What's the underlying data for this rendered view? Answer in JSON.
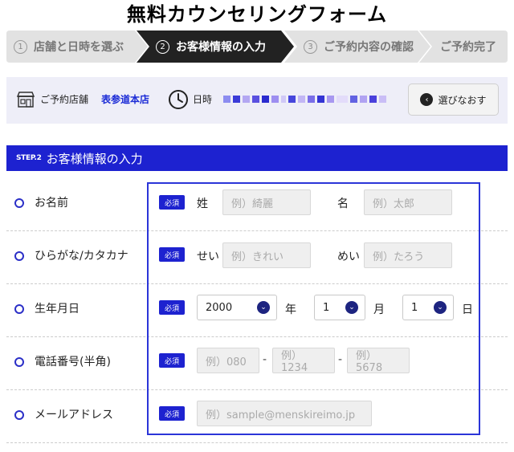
{
  "title": "無料カウンセリングフォーム",
  "steps": [
    {
      "num": "1",
      "label": "店舗と日時を選ぶ",
      "active": false
    },
    {
      "num": "2",
      "label": "お客様情報の入力",
      "active": true
    },
    {
      "num": "3",
      "label": "ご予約内容の確認",
      "active": false
    },
    {
      "num": "",
      "label": "ご予約完了",
      "active": false
    }
  ],
  "store": {
    "label": "ご予約店舗",
    "name": "表参道本店",
    "datetime_label": "日時",
    "redo_label": "選びなおす"
  },
  "section": {
    "step": "STEP.2",
    "title": "お客様情報の入力"
  },
  "required_label": "必須",
  "form": {
    "name": {
      "label": "お名前",
      "last_prefix": "姓",
      "last_placeholder": "例）綺麗",
      "first_prefix": "名",
      "first_placeholder": "例）太郎"
    },
    "kana": {
      "label": "ひらがな/カタカナ",
      "last_prefix": "せい",
      "last_placeholder": "例）きれい",
      "first_prefix": "めい",
      "first_placeholder": "例）たろう"
    },
    "birthday": {
      "label": "生年月日",
      "year_value": "2000",
      "year_suffix": "年",
      "month_value": "1",
      "month_suffix": "月",
      "day_value": "1",
      "day_suffix": "日"
    },
    "phone": {
      "label": "電話番号(半角)",
      "p1_placeholder": "例）080",
      "p2_placeholder": "例）1234",
      "p3_placeholder": "例）5678",
      "dash": "-"
    },
    "email": {
      "label": "メールアドレス",
      "placeholder": "例）sample@menskireimo.jp"
    }
  },
  "colors": {
    "primary": "#1d22d0",
    "active_step": "#222222",
    "inactive_step": "#e2e2e2",
    "store_bar": "#eeeef8",
    "store_name": "#1a2ad6"
  }
}
